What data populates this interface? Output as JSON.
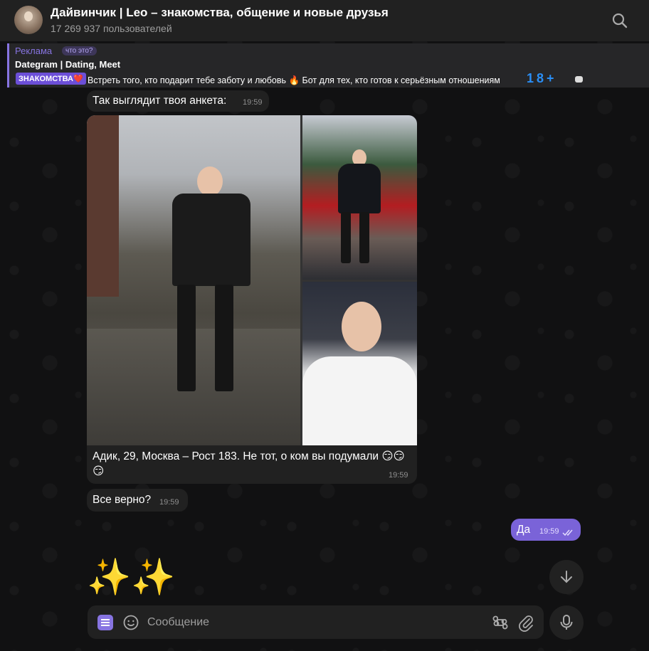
{
  "header": {
    "title": "Дайвинчик | Leo – знакомства, общение и новые друзья",
    "subtitle": "17 269 937 пользователей"
  },
  "ad": {
    "label": "Реклама",
    "what_is": "что это?",
    "title": "Dategram | Dating, Meet",
    "tag": "ЗНАКОМСТВА❤️",
    "text": "Встреть того, кто подарит тебе заботу и любовь 🔥 Бот для тех, кто готов к серьёзным отношениям",
    "digits": "18+"
  },
  "messages": {
    "intro_text": "Так выглядит твоя анкета:",
    "intro_time": "19:59",
    "caption": "Адик, 29, Москва – Рост 183. Не тот, о ком вы подумали 😏😏😏",
    "caption_time": "19:59",
    "confirm_text": "Все верно?",
    "confirm_time": "19:59",
    "reply_text": "Да",
    "reply_time": "19:59"
  },
  "sticker": "✨✨🔍",
  "composer": {
    "placeholder": "Сообщение"
  },
  "colors": {
    "accent": "#8774e1",
    "outgoing_bubble": "#7a63d8",
    "bubble": "#212121"
  }
}
